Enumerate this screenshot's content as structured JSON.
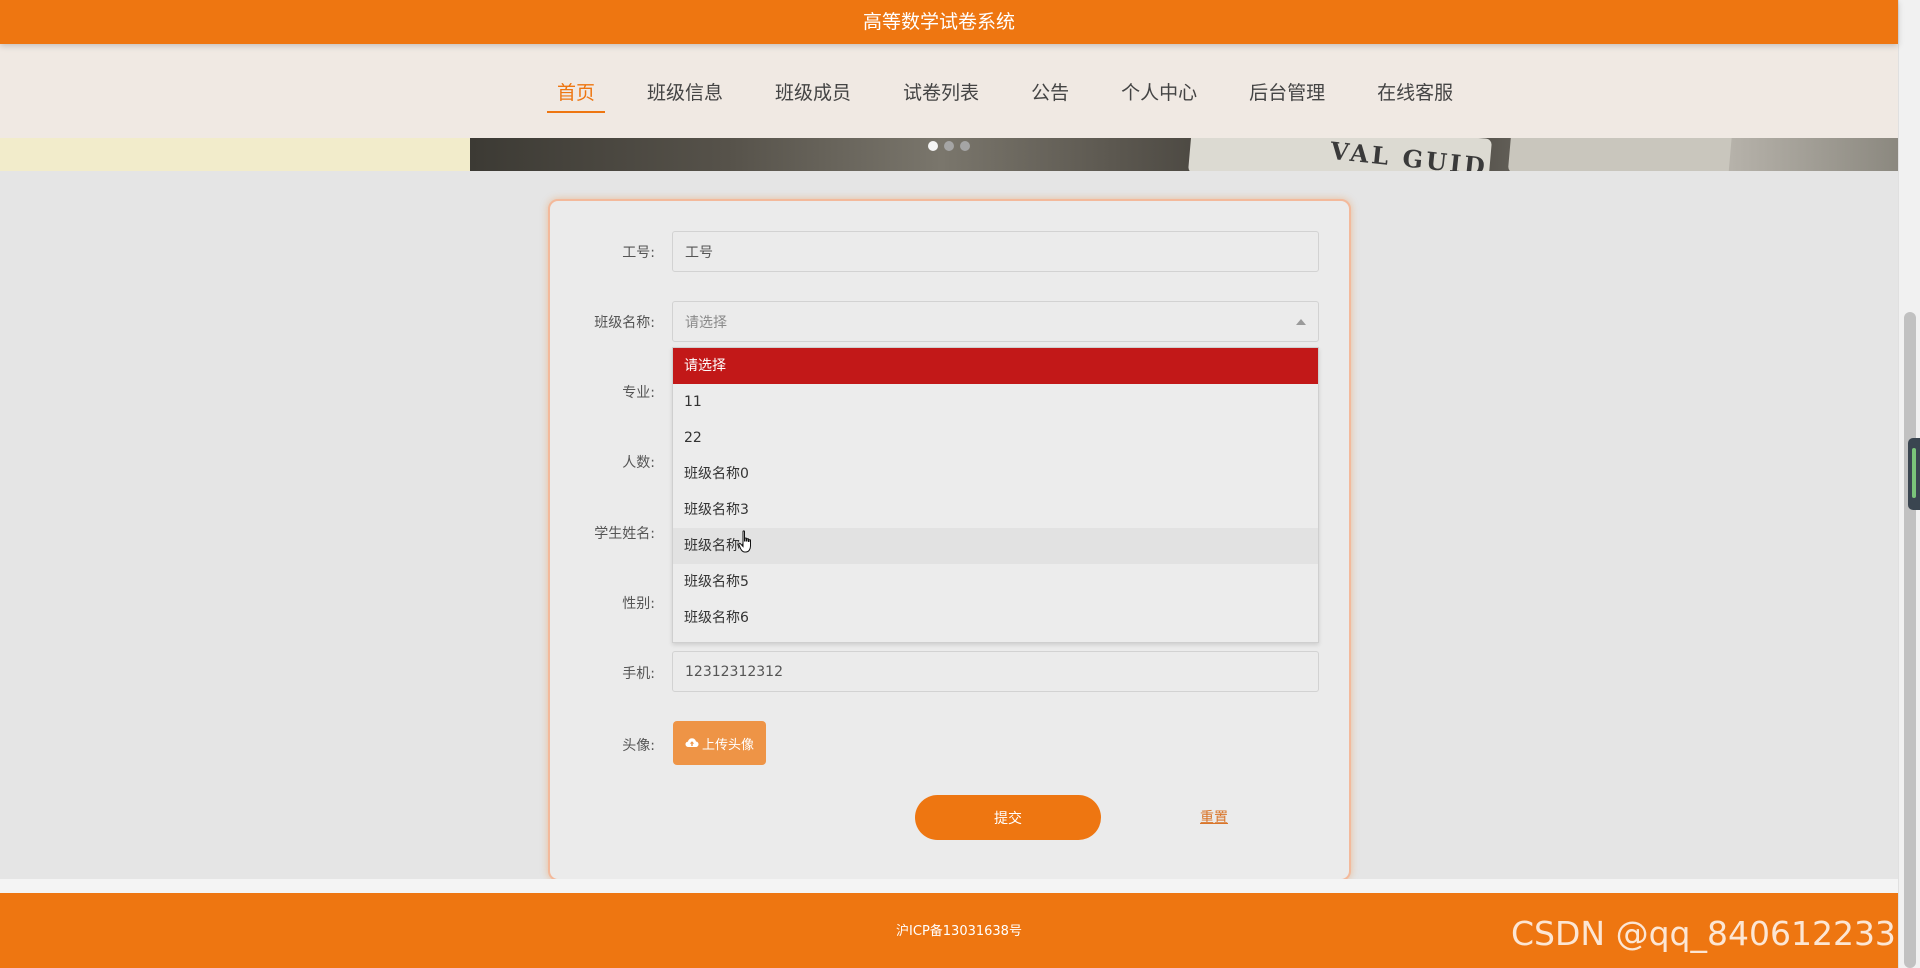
{
  "header": {
    "site_title": "高等数学试卷系统"
  },
  "nav": {
    "items": [
      {
        "label": "首页",
        "active": true
      },
      {
        "label": "班级信息",
        "active": false
      },
      {
        "label": "班级成员",
        "active": false
      },
      {
        "label": "试卷列表",
        "active": false
      },
      {
        "label": "公告",
        "active": false
      },
      {
        "label": "个人中心",
        "active": false
      },
      {
        "label": "后台管理",
        "active": false
      },
      {
        "label": "在线客服",
        "active": false
      }
    ]
  },
  "banner": {
    "image_text": "VAL GUID",
    "carousel_dots": 3,
    "active_dot": 0
  },
  "form": {
    "fields": {
      "employee_id": {
        "label": "工号:",
        "value": "工号"
      },
      "class_name": {
        "label": "班级名称:",
        "placeholder": "请选择"
      },
      "major": {
        "label": "专业:"
      },
      "headcount": {
        "label": "人数:"
      },
      "student_name": {
        "label": "学生姓名:"
      },
      "gender": {
        "label": "性别:"
      },
      "phone": {
        "label": "手机:",
        "value": "12312312312"
      },
      "avatar": {
        "label": "头像:",
        "button_label": "上传头像"
      }
    },
    "dropdown": {
      "options": [
        "请选择",
        "11",
        "22",
        "班级名称0",
        "班级名称3",
        "班级名称4",
        "班级名称5",
        "班级名称6"
      ],
      "selected_index": 0,
      "hover_index": 5
    },
    "submit_label": "提交",
    "reset_label": "重置"
  },
  "footer": {
    "icp": "沪ICP备13031638号"
  },
  "watermark": "CSDN @qq_840612233",
  "colors": {
    "primary": "#ee7611",
    "selected_option": "#c21818",
    "upload_button": "#ee9446",
    "nav_background": "#f0e9e3"
  },
  "icons": {
    "upload": "cloud-upload-icon",
    "select_arrow": "caret-up-icon",
    "cursor": "hand-pointer-icon"
  }
}
